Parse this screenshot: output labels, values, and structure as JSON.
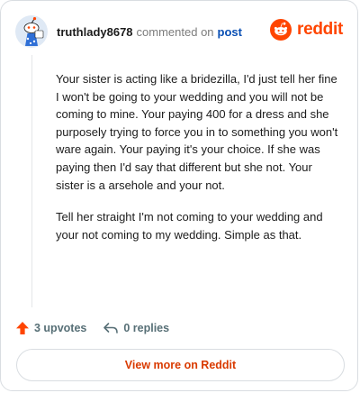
{
  "comment": {
    "username": "truthlady8678",
    "commented_on_text": "commented on",
    "post_link_text": "post",
    "paragraphs": [
      "Your sister is acting like a bridezilla, I'd just tell her fine I won't be going to your wedding and you will not be coming to mine. Your paying 400 for a dress and she purposely trying to force you in to something you won't ware again. Your paying it's your choice. If she was paying then I'd say that different but she not. Your sister is a arsehole and your not.",
      "Tell her straight I'm not coming to your wedding and your not coming to my wedding. Simple as that."
    ],
    "upvotes": "3 upvotes",
    "replies": "0 replies"
  },
  "brand": {
    "name": "reddit",
    "color": "#ff4500"
  },
  "footer": {
    "view_more_label": "View more on Reddit"
  },
  "icons": {
    "avatar": "snoo-avatar-icon",
    "upvote": "upvote-arrow-icon",
    "reply": "reply-arrow-icon",
    "logo": "reddit-snoo-logo-icon"
  },
  "colors": {
    "link": "#0a4fb4",
    "upvote": "#ff4500",
    "cta": "#d93a00",
    "muted": "#576f76"
  }
}
